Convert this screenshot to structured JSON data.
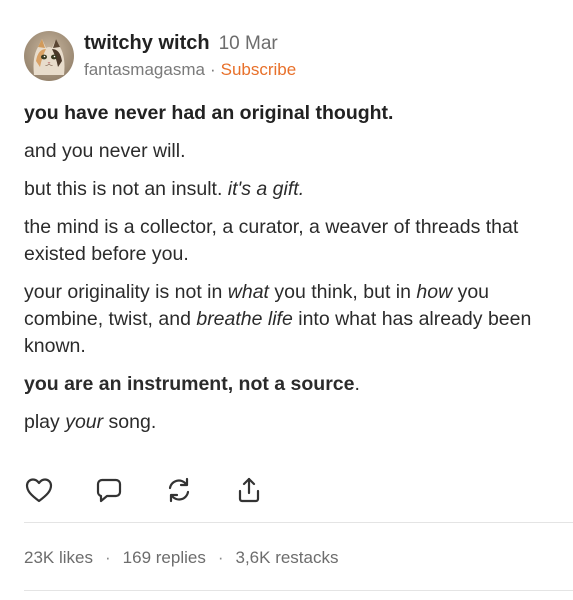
{
  "header": {
    "author": "twitchy witch",
    "date": "10 Mar",
    "publication": "fantasmagasma",
    "separator": "·",
    "subscribe_label": "Subscribe"
  },
  "body": {
    "p1": "you have never had an original thought.",
    "p2": "and you never will.",
    "p3_a": "but this is not an insult. ",
    "p3_b": "it's a gift.",
    "p4": "the mind is a collector, a curator, a weaver of threads that existed before you.",
    "p5_a": "your originality is not in ",
    "p5_b": "what",
    "p5_c": " you think, but in ",
    "p5_d": "how",
    "p5_e": " you combine, twist, and ",
    "p5_f": "breathe life",
    "p5_g": " into what has already been known.",
    "p6_a": "you are an instrument, not a source",
    "p6_b": ".",
    "p7_a": "play ",
    "p7_b": "your",
    "p7_c": " song."
  },
  "actions": {
    "like_icon": "heart-icon",
    "reply_icon": "comment-icon",
    "restack_icon": "restack-icon",
    "share_icon": "share-icon"
  },
  "stats": {
    "likes": "23K likes",
    "replies": "169 replies",
    "restacks": "3,6K restacks",
    "separator": "·"
  },
  "colors": {
    "accent": "#e8702a",
    "text": "#2b2b2b",
    "muted": "#6d6d6d",
    "divider": "#e4e4e4"
  }
}
